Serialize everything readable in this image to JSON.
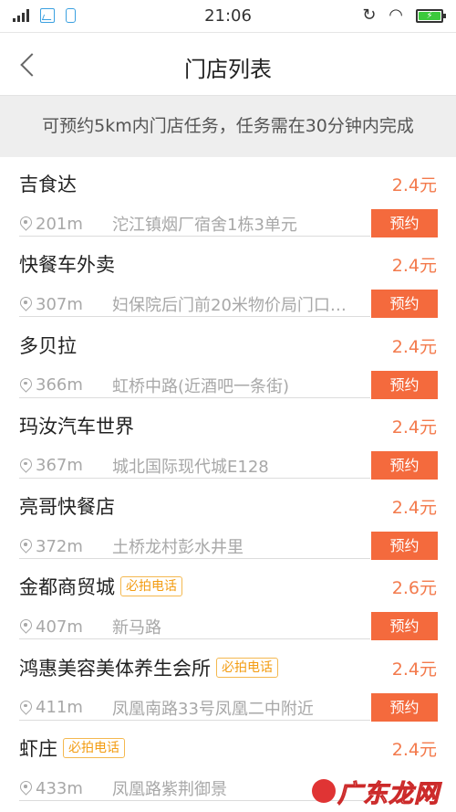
{
  "status_bar": {
    "time": "21:06",
    "battery_level": 1.0
  },
  "header": {
    "title": "门店列表"
  },
  "notice": {
    "text": "可预约5km内门店任务，任务需在30分钟内完成"
  },
  "stores": [
    {
      "name": "吉食达",
      "tag": "",
      "price": "2.4元",
      "distance": "201m",
      "address": "沱江镇烟厂宿舍1栋3单元",
      "action": "预约"
    },
    {
      "name": "快餐车外卖",
      "tag": "",
      "price": "2.4元",
      "distance": "307m",
      "address": "妇保院后门前20米物价局门口…",
      "action": "预约"
    },
    {
      "name": "多贝拉",
      "tag": "",
      "price": "2.4元",
      "distance": "366m",
      "address": "虹桥中路(近酒吧一条街)",
      "action": "预约"
    },
    {
      "name": "玛汝汽车世界",
      "tag": "",
      "price": "2.4元",
      "distance": "367m",
      "address": "城北国际现代城E128",
      "action": "预约"
    },
    {
      "name": "亮哥快餐店",
      "tag": "",
      "price": "2.4元",
      "distance": "372m",
      "address": "土桥龙村彭水井里",
      "action": "预约"
    },
    {
      "name": "金都商贸城",
      "tag": "必拍电话",
      "price": "2.6元",
      "distance": "407m",
      "address": "新马路",
      "action": "预约"
    },
    {
      "name": "鸿惠美容美体养生会所",
      "tag": "必拍电话",
      "price": "2.4元",
      "distance": "411m",
      "address": "凤凰南路33号凤凰二中附近",
      "action": "预约"
    },
    {
      "name": "虾庄",
      "tag": "必拍电话",
      "price": "2.4元",
      "distance": "433m",
      "address": "凤凰路紫荆御景",
      "action": ""
    }
  ],
  "watermark": {
    "text": "广东龙网"
  }
}
